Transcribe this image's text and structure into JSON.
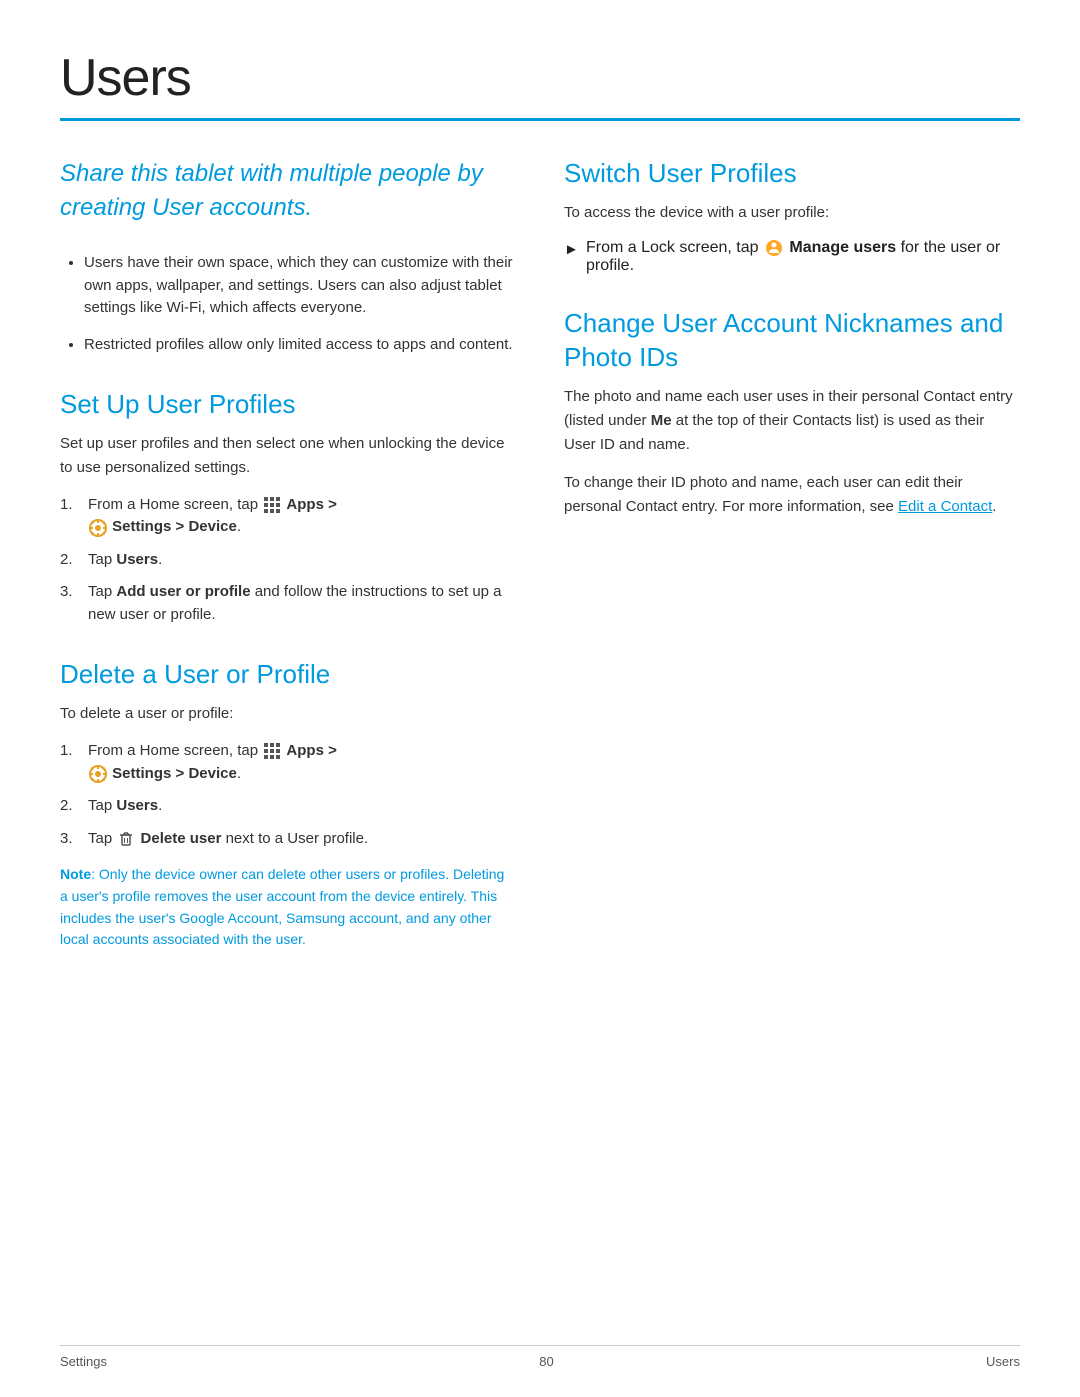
{
  "page": {
    "title": "Users",
    "footer": {
      "left": "Settings",
      "center": "80",
      "right": "Users"
    }
  },
  "intro": {
    "italic_text": "Share this tablet with multiple people by creating User accounts.",
    "bullets": [
      "Users have their own space, which they can customize with their own apps, wallpaper, and settings. Users can also adjust tablet settings like Wi-Fi, which affects everyone.",
      "Restricted profiles allow only limited access to apps and content."
    ]
  },
  "sections": {
    "setup": {
      "title": "Set Up User Profiles",
      "body": "Set up user profiles and then select one when unlocking the device to use personalized settings.",
      "steps": [
        {
          "num": "1.",
          "text_before": "From a Home screen, tap",
          "apps_icon": true,
          "apps_label": "Apps >",
          "settings_icon": true,
          "settings_label": "Settings > Device",
          "suffix": "."
        },
        {
          "num": "2.",
          "text": "Tap",
          "bold": "Users",
          "after": "."
        },
        {
          "num": "3.",
          "text": "Tap",
          "bold": "Add user or profile",
          "after": " and follow the instructions to set up a new user or profile."
        }
      ]
    },
    "delete": {
      "title": "Delete a User or Profile",
      "body": "To delete a user or profile:",
      "steps": [
        {
          "num": "1.",
          "text_before": "From a Home screen, tap",
          "apps_icon": true,
          "apps_label": "Apps >",
          "settings_icon": true,
          "settings_label": "Settings > Device",
          "suffix": "."
        },
        {
          "num": "2.",
          "text": "Tap",
          "bold": "Users",
          "after": "."
        },
        {
          "num": "3.",
          "text": "Tap",
          "trash_icon": true,
          "bold": "Delete user",
          "after": " next to a User profile."
        }
      ],
      "note_label": "Note",
      "note_text": ": Only the device owner can delete other users or profiles. Deleting a user's profile removes the user account from the device entirely. This includes the user's Google Account, Samsung account, and any other local accounts associated with the user."
    },
    "switch": {
      "title": "Switch User Profiles",
      "body": "To access the device with a user profile:",
      "arrow_item": {
        "text_before": "From a Lock screen, tap",
        "manage_icon": true,
        "bold": "Manage users",
        "after": " for the user or profile."
      }
    },
    "change": {
      "title": "Change User Account Nicknames and Photo IDs",
      "body1": "The photo and name each user uses in their personal Contact entry (listed under",
      "bold1": "Me",
      "body1_after": " at the top of their Contacts list) is used as their User ID and name.",
      "body2_before": "To change their ID photo and name, each user can edit their personal Contact entry. For more information, see ",
      "link": "Edit a Contact",
      "body2_after": "."
    }
  }
}
